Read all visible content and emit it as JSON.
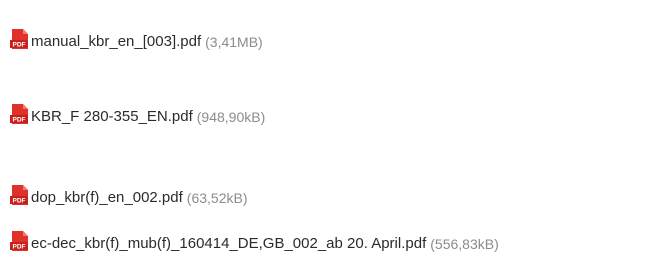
{
  "files": [
    {
      "name": "manual_kbr_en_[003].pdf",
      "size": "(3,41MB)",
      "icon": "pdf-file-icon"
    },
    {
      "name": "KBR_F 280-355_EN.pdf",
      "size": "(948,90kB)",
      "icon": "pdf-file-icon"
    },
    {
      "name": "dop_kbr(f)_en_002.pdf",
      "size": "(63,52kB)",
      "icon": "pdf-file-icon"
    },
    {
      "name": "ec-dec_kbr(f)_mub(f)_160414_DE,GB_002_ab 20. April.pdf",
      "size": "(556,83kB)",
      "icon": "pdf-file-icon"
    }
  ],
  "colors": {
    "pdf_icon": "#e0322b",
    "name_text": "#2b2b2b",
    "size_text": "#8c8c8c"
  }
}
